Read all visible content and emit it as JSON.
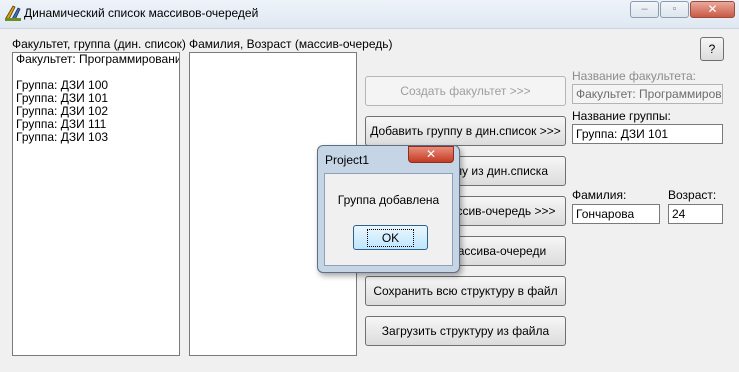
{
  "window": {
    "title": "Динамический список массивов-очередей",
    "minimize_glyph": "–",
    "maximize_glyph": "▫",
    "close_glyph": "✕",
    "help_label": "?"
  },
  "lists": {
    "faculty_label": "Факультет, группа (дин. список)",
    "faculty_lines": [
      "Факультет: Программирование",
      "",
      "Группа: ДЗИ 100",
      "Группа: ДЗИ 101",
      "Группа: ДЗИ 102",
      "Группа: ДЗИ 111",
      "Группа: ДЗИ 103"
    ],
    "person_label": "Фамилия, Возраст (массив-очередь)",
    "person_lines": []
  },
  "buttons": {
    "create_faculty": "Создать факультет >>>",
    "add_group": "Добавить группу в дин.список >>>",
    "remove_group": "Удалить группу из дин.списка",
    "add_to_queue": "Добавить в массив-очередь >>>",
    "remove_from_queue": "Удалить из массива-очереди",
    "save_structure": "Сохранить всю структуру в файл",
    "load_structure": "Загрузить структуру из файла"
  },
  "fields": {
    "faculty_name_label": "Название факультета:",
    "faculty_name_value": "Факультет: Программирование",
    "group_name_label": "Название группы:",
    "group_name_value": "Группа: ДЗИ 101",
    "surname_label": "Фамилия:",
    "surname_value": "Гончарова",
    "age_label": "Возраст:",
    "age_value": "24"
  },
  "dialog": {
    "title": "Project1",
    "close_glyph": "✕",
    "message": "Группа добавлена",
    "ok_label": "OK"
  }
}
